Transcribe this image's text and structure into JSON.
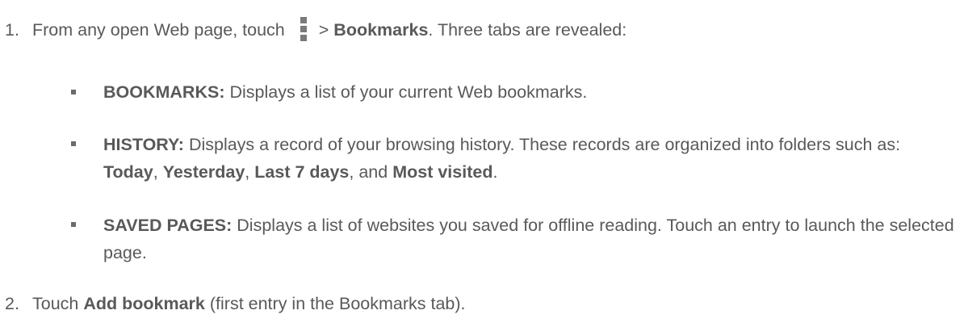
{
  "step1": {
    "number": "1.",
    "before_icon": "From any open Web page, touch",
    "icon": "menu-kebab-icon",
    "after_icon_gt": ">",
    "bold_target": "Bookmarks",
    "after_bold": ". Three tabs are revealed:"
  },
  "tabs": [
    {
      "name": "BOOKMARKS:",
      "desc": "Displays a list of your current Web bookmarks."
    },
    {
      "name": "HISTORY:",
      "desc_part1": "Displays a record of your browsing history. These records are organized into folders such as:",
      "folders": [
        "Today",
        "Yesterday",
        "Last 7 days",
        "Most visited"
      ],
      "sep1": ",",
      "sep2": ",",
      "sep3": ", and",
      "end": "."
    },
    {
      "name": "SAVED PAGES:",
      "desc": "Displays a list of websites you saved for offline reading. Touch an entry to launch the selected page."
    }
  ],
  "step2": {
    "number": "2.",
    "before": "Touch",
    "bold_target": "Add bookmark",
    "after": "(first entry in the Bookmarks tab)."
  }
}
